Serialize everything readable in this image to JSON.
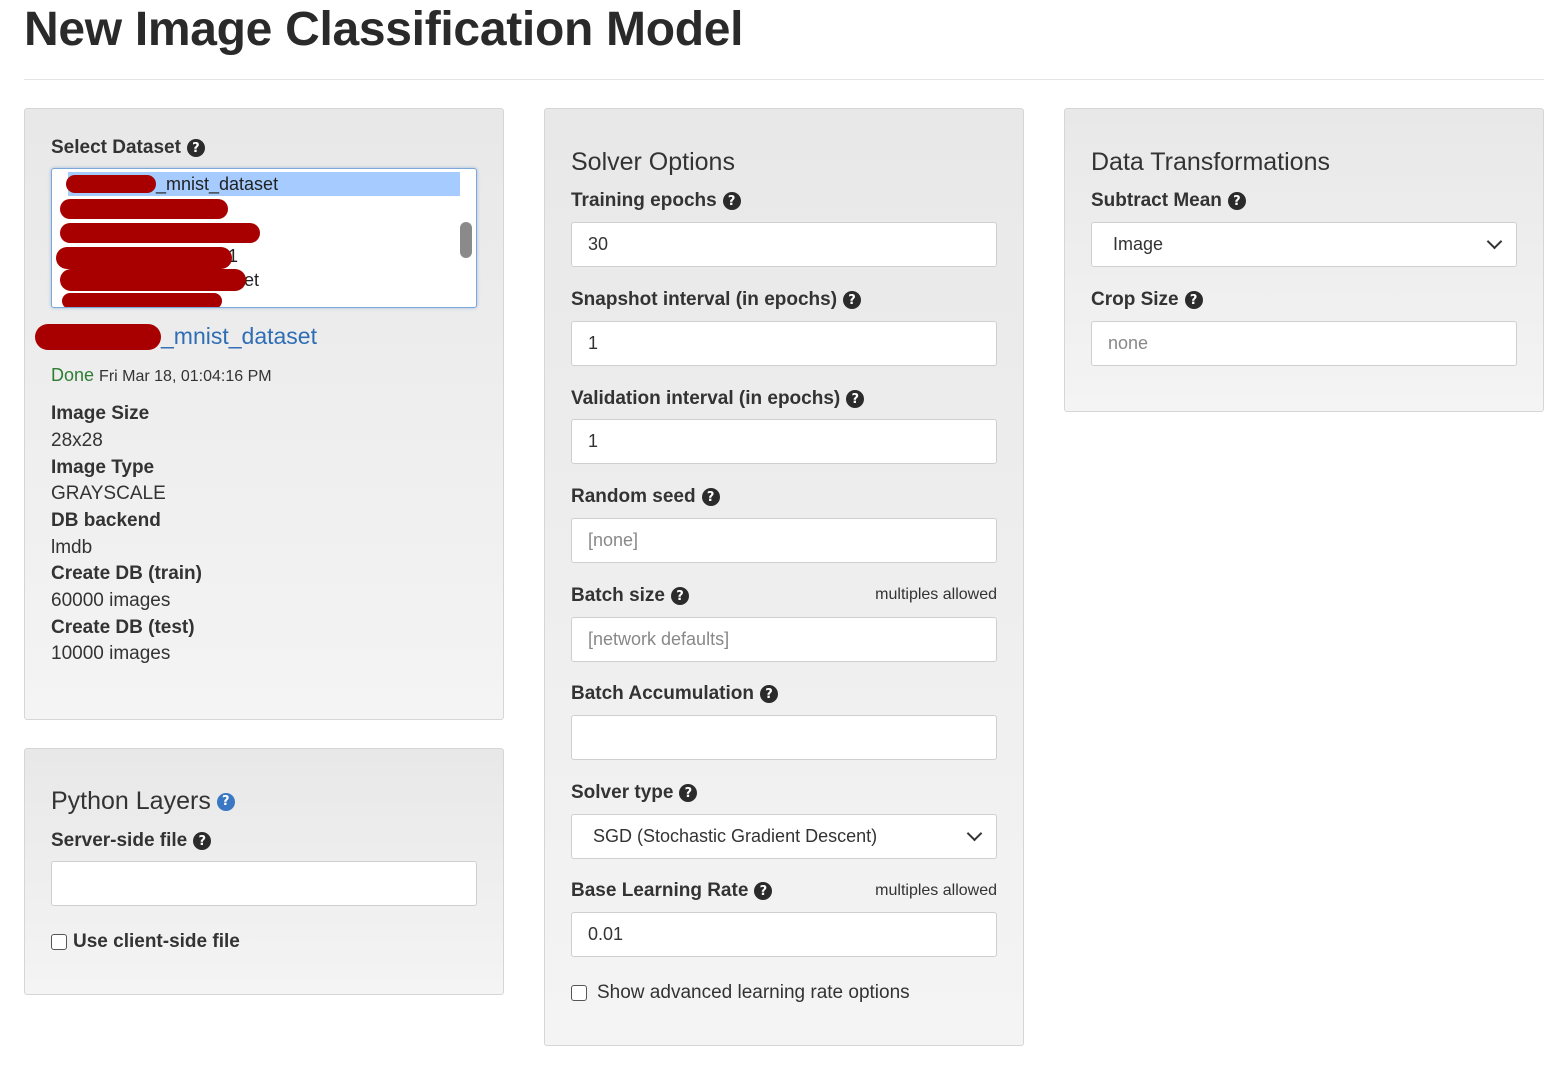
{
  "page": {
    "title": "New Image Classification Model"
  },
  "dataset_panel": {
    "select_label": "Select Dataset",
    "list_items": [
      "_mnist_dataset",
      "",
      "",
      "1",
      "et",
      ""
    ],
    "selected_dataset_link": "_mnist_dataset",
    "status": "Done",
    "status_time": "Fri Mar 18, 01:04:16 PM",
    "details": [
      {
        "label": "Image Size",
        "value": "28x28"
      },
      {
        "label": "Image Type",
        "value": "GRAYSCALE"
      },
      {
        "label": "DB backend",
        "value": "lmdb"
      },
      {
        "label": "Create DB (train)",
        "value": "60000 images"
      },
      {
        "label": "Create DB (test)",
        "value": "10000 images"
      }
    ]
  },
  "python_layers": {
    "title": "Python Layers",
    "server_file_label": "Server-side file",
    "server_file_value": "",
    "client_file_label": "Use client-side file"
  },
  "solver": {
    "title": "Solver Options",
    "training_epochs_label": "Training epochs",
    "training_epochs_value": "30",
    "snapshot_label": "Snapshot interval (in epochs)",
    "snapshot_value": "1",
    "validation_label": "Validation interval (in epochs)",
    "validation_value": "1",
    "seed_label": "Random seed",
    "seed_placeholder": "[none]",
    "batch_label": "Batch size",
    "batch_note": "multiples allowed",
    "batch_placeholder": "[network defaults]",
    "accum_label": "Batch Accumulation",
    "accum_value": "",
    "solver_type_label": "Solver type",
    "solver_type_value": "SGD (Stochastic Gradient Descent)",
    "lr_label": "Base Learning Rate",
    "lr_note": "multiples allowed",
    "lr_value": "0.01",
    "advanced_lr_label": "Show advanced learning rate options"
  },
  "transforms": {
    "title": "Data Transformations",
    "subtract_mean_label": "Subtract Mean",
    "subtract_mean_value": "Image",
    "crop_label": "Crop Size",
    "crop_placeholder": "none"
  },
  "colors": {
    "link": "#2f6db5",
    "done_green": "#2e7d32",
    "selection": "#a6ccff",
    "redaction": "#a80000"
  }
}
